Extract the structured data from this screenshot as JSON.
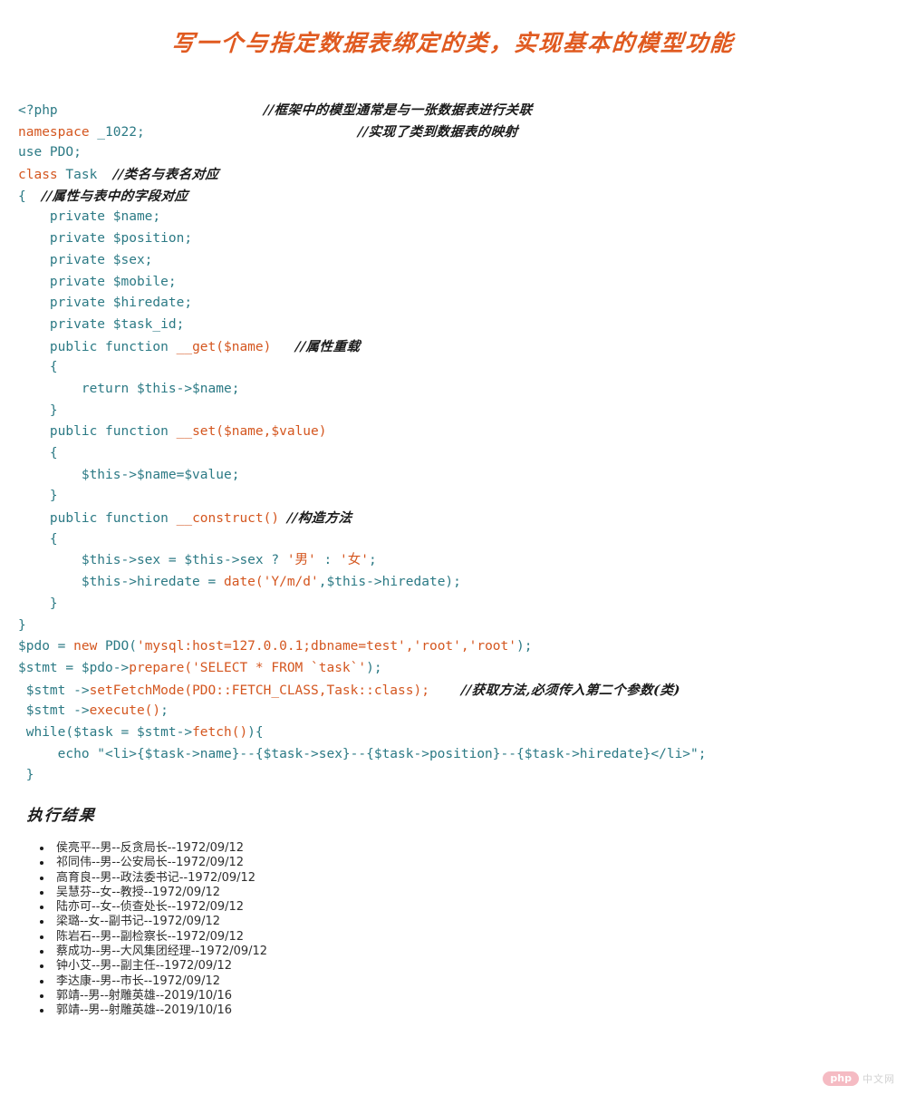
{
  "title": "写一个与指定数据表绑定的类，实现基本的模型功能",
  "colors": {
    "title_orange": "#e05a20",
    "code_teal": "#2c7a85",
    "code_orange": "#d4561f",
    "comment_black": "#1b1b1b",
    "list_text": "#2d2d2d",
    "watermark_badge": "#e8576b"
  },
  "code": {
    "language": "php",
    "lines": [
      {
        "indent": 0,
        "segments": [
          {
            "t": "<?php",
            "c": "plain"
          }
        ],
        "comment": "//框架中的模型通常是与一张数据表进行关联",
        "comment_col": 26
      },
      {
        "indent": 0,
        "segments": [
          {
            "t": "namespace",
            "c": "key"
          },
          {
            "t": " _1022;",
            "c": "plain"
          }
        ],
        "comment": "//实现了类到数据表的映射",
        "comment_col": 27
      },
      {
        "indent": 0,
        "segments": [
          {
            "t": "use PDO;",
            "c": "plain"
          }
        ],
        "comment": "",
        "comment_col": 0
      },
      {
        "indent": 0,
        "segments": [
          {
            "t": "class",
            "c": "key"
          },
          {
            "t": " Task  ",
            "c": "plain"
          }
        ],
        "comment": "//类名与表名对应",
        "comment_col": 0
      },
      {
        "indent": 0,
        "segments": [
          {
            "t": "{  ",
            "c": "plain"
          }
        ],
        "comment": "//属性与表中的字段对应",
        "comment_col": 0
      },
      {
        "indent": 4,
        "segments": [
          {
            "t": "private $name;",
            "c": "plain"
          }
        ],
        "comment": "",
        "comment_col": 0
      },
      {
        "indent": 4,
        "segments": [
          {
            "t": "private $position;",
            "c": "plain"
          }
        ],
        "comment": "",
        "comment_col": 0
      },
      {
        "indent": 4,
        "segments": [
          {
            "t": "private $sex;",
            "c": "plain"
          }
        ],
        "comment": "",
        "comment_col": 0
      },
      {
        "indent": 4,
        "segments": [
          {
            "t": "private $mobile;",
            "c": "plain"
          }
        ],
        "comment": "",
        "comment_col": 0
      },
      {
        "indent": 4,
        "segments": [
          {
            "t": "private $hiredate;",
            "c": "plain"
          }
        ],
        "comment": "",
        "comment_col": 0
      },
      {
        "indent": 4,
        "segments": [
          {
            "t": "private $task_id;",
            "c": "plain"
          }
        ],
        "comment": "",
        "comment_col": 0
      },
      {
        "indent": 4,
        "segments": [
          {
            "t": "public function ",
            "c": "plain"
          },
          {
            "t": "__get($name)",
            "c": "fn"
          },
          {
            "t": "   ",
            "c": "plain"
          }
        ],
        "comment": "//属性重载",
        "comment_col": 0
      },
      {
        "indent": 4,
        "segments": [
          {
            "t": "{",
            "c": "plain"
          }
        ],
        "comment": "",
        "comment_col": 0
      },
      {
        "indent": 8,
        "segments": [
          {
            "t": "return $this->$name;",
            "c": "plain"
          }
        ],
        "comment": "",
        "comment_col": 0
      },
      {
        "indent": 4,
        "segments": [
          {
            "t": "}",
            "c": "plain"
          }
        ],
        "comment": "",
        "comment_col": 0
      },
      {
        "indent": 4,
        "segments": [
          {
            "t": "public function ",
            "c": "plain"
          },
          {
            "t": "__set($name,$value)",
            "c": "fn"
          }
        ],
        "comment": "",
        "comment_col": 0
      },
      {
        "indent": 4,
        "segments": [
          {
            "t": "{",
            "c": "plain"
          }
        ],
        "comment": "",
        "comment_col": 0
      },
      {
        "indent": 8,
        "segments": [
          {
            "t": "$this->$name=$value;",
            "c": "plain"
          }
        ],
        "comment": "",
        "comment_col": 0
      },
      {
        "indent": 4,
        "segments": [
          {
            "t": "}",
            "c": "plain"
          }
        ],
        "comment": "",
        "comment_col": 0
      },
      {
        "indent": 4,
        "segments": [
          {
            "t": "public function ",
            "c": "plain"
          },
          {
            "t": "__construct()",
            "c": "fn"
          },
          {
            "t": " ",
            "c": "plain"
          }
        ],
        "comment": "//构造方法",
        "comment_col": 0
      },
      {
        "indent": 4,
        "segments": [
          {
            "t": "{",
            "c": "plain"
          }
        ],
        "comment": "",
        "comment_col": 0
      },
      {
        "indent": 8,
        "segments": [
          {
            "t": "$this->sex = $this->sex ? ",
            "c": "plain"
          },
          {
            "t": "'男'",
            "c": "str"
          },
          {
            "t": " : ",
            "c": "plain"
          },
          {
            "t": "'女'",
            "c": "str"
          },
          {
            "t": ";",
            "c": "plain"
          }
        ],
        "comment": "",
        "comment_col": 0
      },
      {
        "indent": 8,
        "segments": [
          {
            "t": "$this->hiredate = ",
            "c": "plain"
          },
          {
            "t": "date('Y/m/d'",
            "c": "str"
          },
          {
            "t": ",$this->hiredate);",
            "c": "plain"
          }
        ],
        "comment": "",
        "comment_col": 0
      },
      {
        "indent": 4,
        "segments": [
          {
            "t": "}",
            "c": "plain"
          }
        ],
        "comment": "",
        "comment_col": 0
      },
      {
        "indent": 0,
        "segments": [
          {
            "t": "}",
            "c": "plain"
          }
        ],
        "comment": "",
        "comment_col": 0
      },
      {
        "indent": 0,
        "segments": [
          {
            "t": "$pdo = ",
            "c": "plain"
          },
          {
            "t": "new",
            "c": "key"
          },
          {
            "t": " PDO(",
            "c": "plain"
          },
          {
            "t": "'mysql:host=127.0.0.1;dbname=test','root','root'",
            "c": "str"
          },
          {
            "t": ");",
            "c": "plain"
          }
        ],
        "comment": "",
        "comment_col": 0
      },
      {
        "indent": 0,
        "segments": [
          {
            "t": "$stmt = $pdo->",
            "c": "plain"
          },
          {
            "t": "prepare(",
            "c": "fn"
          },
          {
            "t": "'SELECT * FROM `task`'",
            "c": "str"
          },
          {
            "t": ");",
            "c": "plain"
          }
        ],
        "comment": "",
        "comment_col": 0
      },
      {
        "indent": 0,
        "segments": [
          {
            "t": " $stmt ->",
            "c": "plain"
          },
          {
            "t": "setFetchMode(PDO::FETCH_CLASS,Task::class);",
            "c": "fn"
          },
          {
            "t": "    ",
            "c": "plain"
          }
        ],
        "comment": "//获取方法,必须传入第二个参数(类)",
        "comment_col": 0
      },
      {
        "indent": 0,
        "segments": [
          {
            "t": " $stmt ->",
            "c": "plain"
          },
          {
            "t": "execute()",
            "c": "fn"
          },
          {
            "t": ";",
            "c": "plain"
          }
        ],
        "comment": "",
        "comment_col": 0
      },
      {
        "indent": 0,
        "segments": [
          {
            "t": " while($task = $stmt->",
            "c": "plain"
          },
          {
            "t": "fetch()",
            "c": "fn"
          },
          {
            "t": "){",
            "c": "plain"
          }
        ],
        "comment": "",
        "comment_col": 0
      },
      {
        "indent": 0,
        "segments": [
          {
            "t": "     echo \"<li>{$task->name}--{$task->sex}--{$task->position}--{$task->hiredate}</li>\";",
            "c": "plain"
          }
        ],
        "comment": "",
        "comment_col": 0
      },
      {
        "indent": 0,
        "segments": [
          {
            "t": " }",
            "c": "plain"
          }
        ],
        "comment": "",
        "comment_col": 0
      }
    ]
  },
  "result": {
    "heading": "执行结果",
    "items": [
      "侯亮平--男--反贪局长--1972/09/12",
      "祁同伟--男--公安局长--1972/09/12",
      "高育良--男--政法委书记--1972/09/12",
      "吴慧芬--女--教授--1972/09/12",
      "陆亦可--女--侦查处长--1972/09/12",
      "梁璐--女--副书记--1972/09/12",
      "陈岩石--男--副检察长--1972/09/12",
      "蔡成功--男--大风集团经理--1972/09/12",
      "钟小艾--男--副主任--1972/09/12",
      "李达康--男--市长--1972/09/12",
      "郭靖--男--射雕英雄--2019/10/16",
      "郭靖--男--射雕英雄--2019/10/16"
    ]
  },
  "watermark": {
    "badge": "php",
    "text": "中文网"
  }
}
